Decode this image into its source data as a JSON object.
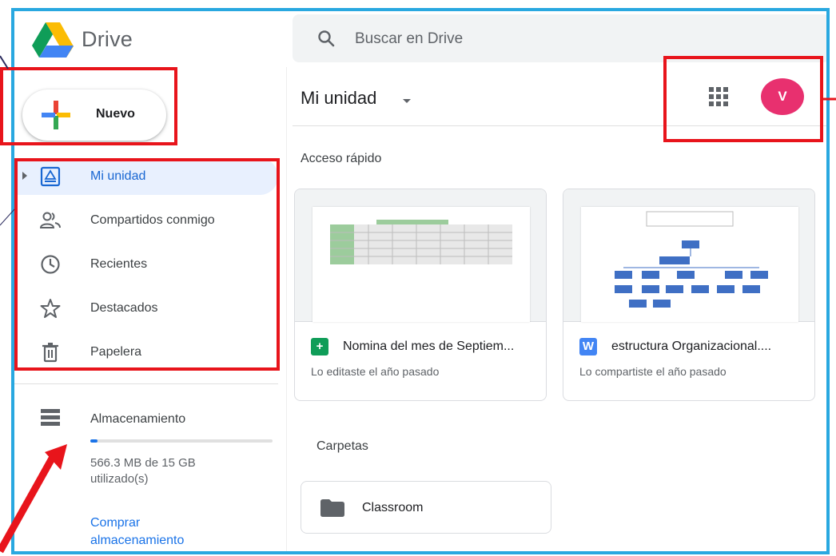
{
  "app": {
    "name": "Drive"
  },
  "search": {
    "placeholder": "Buscar en Drive"
  },
  "new_button": {
    "label": "Nuevo"
  },
  "nav": {
    "items": [
      {
        "label": "Mi unidad",
        "icon": "my-drive-icon",
        "active": true
      },
      {
        "label": "Compartidos conmigo",
        "icon": "shared-people-icon",
        "active": false
      },
      {
        "label": "Recientes",
        "icon": "clock-icon",
        "active": false
      },
      {
        "label": "Destacados",
        "icon": "star-icon",
        "active": false
      },
      {
        "label": "Papelera",
        "icon": "trash-icon",
        "active": false
      }
    ]
  },
  "storage": {
    "label": "Almacenamiento",
    "used_text": "566.3 MB de 15 GB utilizado(s)",
    "used_fraction": 0.038,
    "buy_label": "Comprar almacenamiento"
  },
  "main": {
    "title": "Mi unidad",
    "quick_access_label": "Acceso rápido",
    "cards": [
      {
        "title": "Nomina del mes de Septiem...",
        "subtitle": "Lo editaste el año pasado",
        "file_type": "sheets",
        "file_type_glyph": "+",
        "file_color": "#0f9d58"
      },
      {
        "title": "estructura Organizacional....",
        "subtitle": "Lo compartiste el año pasado",
        "file_type": "docs",
        "file_type_glyph": "W",
        "file_color": "#4285f4"
      }
    ],
    "folders_label": "Carpetas",
    "folders": [
      {
        "name": "Classroom"
      }
    ]
  },
  "account": {
    "initial": "V",
    "avatar_color": "#e8306f"
  },
  "colors": {
    "accent": "#1a73e8",
    "active_bg": "#e8f0fe",
    "annotation_red": "#e8141b",
    "frame_blue": "#29a8e0"
  }
}
